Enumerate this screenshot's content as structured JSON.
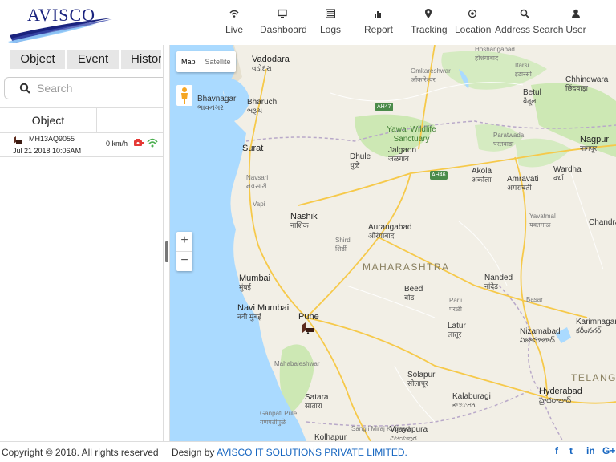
{
  "brand": {
    "name": "AVISCO"
  },
  "nav": [
    {
      "label": "Live",
      "icon": "wifi-icon"
    },
    {
      "label": "Dashboard",
      "icon": "monitor-icon"
    },
    {
      "label": "Logs",
      "icon": "list-icon"
    },
    {
      "label": "Report",
      "icon": "bar-chart-icon"
    },
    {
      "label": "Tracking",
      "icon": "map-pin-icon"
    },
    {
      "label": "Location",
      "icon": "target-icon"
    },
    {
      "label": "Address Search",
      "icon": "search-icon"
    },
    {
      "label": "User",
      "icon": "user-icon"
    }
  ],
  "sidebar": {
    "tabs": [
      "Object",
      "Event",
      "History"
    ],
    "search_placeholder": "Search",
    "table_header": "Object",
    "rows": [
      {
        "plate": "MH13AQ9055",
        "time": "Jul 21 2018 10:06AM",
        "speed": "0 km/h"
      }
    ]
  },
  "map": {
    "type_buttons": [
      "Map",
      "Satellite"
    ],
    "zoom_in": "+",
    "zoom_out": "−",
    "state_labels": [
      "MAHARASHTRA",
      "TELANG"
    ],
    "regions": [
      "Yawal Wildlife",
      "Sanctuary"
    ],
    "highways": [
      "AH47",
      "AH46"
    ],
    "cities": [
      {
        "name": "Vadodara",
        "local": "વડોદરા"
      },
      {
        "name": "Bharuch",
        "local": "ભરૂચ"
      },
      {
        "name": "Bhavnagar",
        "local": "ભાવનગર"
      },
      {
        "name": "Surat",
        "local": ""
      },
      {
        "name": "Navsari",
        "local": "નવસારી"
      },
      {
        "name": "Vapi",
        "local": ""
      },
      {
        "name": "Nashik",
        "local": "नाशिक"
      },
      {
        "name": "Mumbai",
        "local": "मुंबई"
      },
      {
        "name": "Navi Mumbai",
        "local": "नवी मुंबई"
      },
      {
        "name": "Pune",
        "local": ""
      },
      {
        "name": "Dhule",
        "local": "धुळे"
      },
      {
        "name": "Jalgaon",
        "local": "जळगाव"
      },
      {
        "name": "Aurangabad",
        "local": "औरंगाबाद"
      },
      {
        "name": "Shirdi",
        "local": "शिर्डी"
      },
      {
        "name": "Akola",
        "local": "अकोला"
      },
      {
        "name": "Amravati",
        "local": "अमरावती"
      },
      {
        "name": "Wardha",
        "local": "वर्धा"
      },
      {
        "name": "Nagpur",
        "local": "नागपूर"
      },
      {
        "name": "Chhindwara",
        "local": "छिंदवाड़ा"
      },
      {
        "name": "Betul",
        "local": "बैतूल"
      },
      {
        "name": "Paratwada",
        "local": "परतवाडा"
      },
      {
        "name": "Yavatmal",
        "local": "यवतमाळ"
      },
      {
        "name": "Nanded",
        "local": "नांदेड"
      },
      {
        "name": "Beed",
        "local": "बीड"
      },
      {
        "name": "Latur",
        "local": "लातूर"
      },
      {
        "name": "Solapur",
        "local": "सोलापूर"
      },
      {
        "name": "Satara",
        "local": "सातारा"
      },
      {
        "name": "Kalaburagi",
        "local": "ಕಲಬುರಗಿ"
      },
      {
        "name": "Nizamabad",
        "local": "నిజామాబాద్"
      },
      {
        "name": "Karimnagar",
        "local": "కరీంనగర్"
      },
      {
        "name": "Hyderabad",
        "local": "హైదరాబాద్"
      },
      {
        "name": "Sangli Miraj Kupwad",
        "local": ""
      },
      {
        "name": "Vijayapura",
        "local": "ವಿಜಯಪುರ"
      },
      {
        "name": "Kolhapur",
        "local": ""
      },
      {
        "name": "Mahabaleshwar",
        "local": ""
      },
      {
        "name": "Ganpati Pule",
        "local": "गणपतीपुळे"
      },
      {
        "name": "Chandra",
        "local": ""
      },
      {
        "name": "Basar",
        "local": ""
      },
      {
        "name": "Itarsi",
        "local": "इटारसी"
      },
      {
        "name": "Omkareshwar",
        "local": "ओंकारेश्वर"
      },
      {
        "name": "Hoshangabad",
        "local": "होशंगाबाद"
      },
      {
        "name": "Parli",
        "local": "परळी"
      }
    ]
  },
  "footer": {
    "copyright": "Copyright © 2018. All rights reserved",
    "design_prefix": "Design by ",
    "design_link": "AVISCO IT SOLUTIONS PRIVATE LIMITED.",
    "social": [
      "f",
      "t",
      "in",
      "G+"
    ]
  },
  "colors": {
    "brand_blue": "#1a237e",
    "link_blue": "#1565c0",
    "water": "#aadaff",
    "land": "#f2efe6"
  }
}
